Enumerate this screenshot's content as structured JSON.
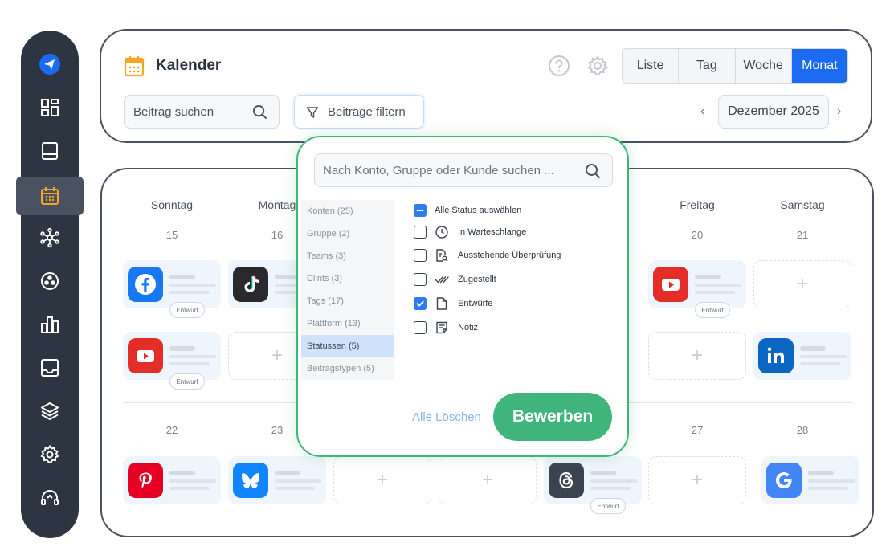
{
  "header": {
    "title": "Kalender",
    "views": [
      "Liste",
      "Tag",
      "Woche",
      "Monat"
    ],
    "active_view": "Monat",
    "search_placeholder": "Beitrag suchen",
    "filter_label": "Beiträge filtern",
    "month": "Dezember 2025"
  },
  "calendar": {
    "days": [
      "Sonntag",
      "Montag",
      "Freitag",
      "Samstag"
    ],
    "week1": [
      "15",
      "16",
      "20",
      "21"
    ],
    "week2": [
      "22",
      "23",
      "27",
      "28"
    ],
    "badge": "Entwurf"
  },
  "filter": {
    "search_placeholder": "Nach Konto, Gruppe oder Kunde suchen ...",
    "categories": [
      "Konten (25)",
      "Gruppe (2)",
      "Teams (3)",
      "Clints (3)",
      "Tags (17)",
      "Plattform (13)",
      "Statussen (5)",
      "Beitragstypen (5)"
    ],
    "active_category": "Statussen (5)",
    "statuses": [
      "Alle Status auswählen",
      "In Warteschlange",
      "Ausstehende Überprüfung",
      "Zugestellt",
      "Entwürfe",
      "Notiz"
    ],
    "checked": [
      "Entwürfe"
    ],
    "clear_label": "Alle Löschen",
    "apply_label": "Bewerben"
  },
  "colors": {
    "sidebar": "#2d3543",
    "accent_blue": "#1a6af2",
    "accent_green": "#3fb57c",
    "calendar_icon": "#f5a623"
  },
  "icons": {
    "sidebar": [
      "paper-plane-icon",
      "dashboard-icon",
      "book-icon",
      "calendar-icon",
      "network-icon",
      "circle-dots-icon",
      "bar-chart-icon",
      "inbox-icon",
      "layers-icon",
      "gear-icon",
      "headset-icon"
    ],
    "platforms": [
      "facebook-icon",
      "tiktok-icon",
      "youtube-icon",
      "linkedin-icon",
      "pinterest-icon",
      "bluesky-icon",
      "threads-icon",
      "google-icon"
    ]
  }
}
